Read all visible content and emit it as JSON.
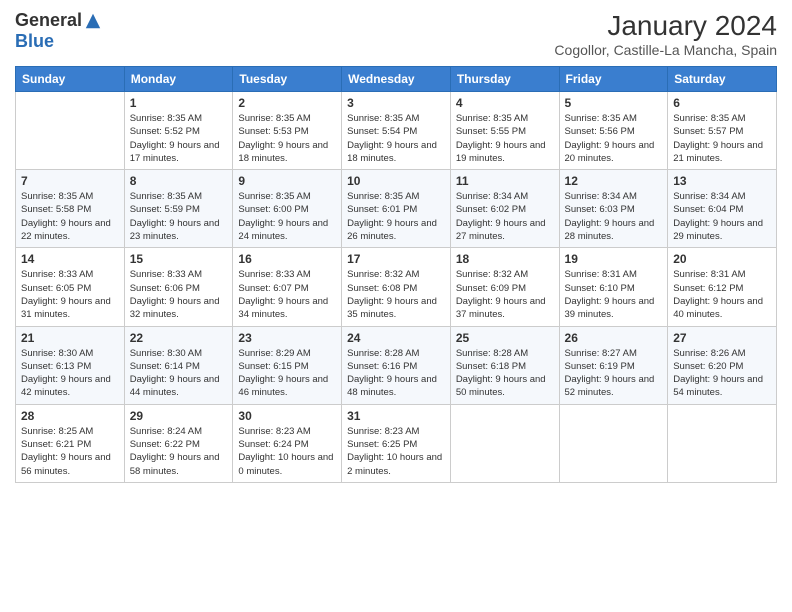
{
  "logo": {
    "general": "General",
    "blue": "Blue"
  },
  "title": "January 2024",
  "location": "Cogollor, Castille-La Mancha, Spain",
  "days_of_week": [
    "Sunday",
    "Monday",
    "Tuesday",
    "Wednesday",
    "Thursday",
    "Friday",
    "Saturday"
  ],
  "weeks": [
    [
      {
        "day": "",
        "sunrise": "",
        "sunset": "",
        "daylight": ""
      },
      {
        "day": "1",
        "sunrise": "8:35 AM",
        "sunset": "5:52 PM",
        "daylight": "9 hours and 17 minutes."
      },
      {
        "day": "2",
        "sunrise": "8:35 AM",
        "sunset": "5:53 PM",
        "daylight": "9 hours and 18 minutes."
      },
      {
        "day": "3",
        "sunrise": "8:35 AM",
        "sunset": "5:54 PM",
        "daylight": "9 hours and 18 minutes."
      },
      {
        "day": "4",
        "sunrise": "8:35 AM",
        "sunset": "5:55 PM",
        "daylight": "9 hours and 19 minutes."
      },
      {
        "day": "5",
        "sunrise": "8:35 AM",
        "sunset": "5:56 PM",
        "daylight": "9 hours and 20 minutes."
      },
      {
        "day": "6",
        "sunrise": "8:35 AM",
        "sunset": "5:57 PM",
        "daylight": "9 hours and 21 minutes."
      }
    ],
    [
      {
        "day": "7",
        "sunrise": "8:35 AM",
        "sunset": "5:58 PM",
        "daylight": "9 hours and 22 minutes."
      },
      {
        "day": "8",
        "sunrise": "8:35 AM",
        "sunset": "5:59 PM",
        "daylight": "9 hours and 23 minutes."
      },
      {
        "day": "9",
        "sunrise": "8:35 AM",
        "sunset": "6:00 PM",
        "daylight": "9 hours and 24 minutes."
      },
      {
        "day": "10",
        "sunrise": "8:35 AM",
        "sunset": "6:01 PM",
        "daylight": "9 hours and 26 minutes."
      },
      {
        "day": "11",
        "sunrise": "8:34 AM",
        "sunset": "6:02 PM",
        "daylight": "9 hours and 27 minutes."
      },
      {
        "day": "12",
        "sunrise": "8:34 AM",
        "sunset": "6:03 PM",
        "daylight": "9 hours and 28 minutes."
      },
      {
        "day": "13",
        "sunrise": "8:34 AM",
        "sunset": "6:04 PM",
        "daylight": "9 hours and 29 minutes."
      }
    ],
    [
      {
        "day": "14",
        "sunrise": "8:33 AM",
        "sunset": "6:05 PM",
        "daylight": "9 hours and 31 minutes."
      },
      {
        "day": "15",
        "sunrise": "8:33 AM",
        "sunset": "6:06 PM",
        "daylight": "9 hours and 32 minutes."
      },
      {
        "day": "16",
        "sunrise": "8:33 AM",
        "sunset": "6:07 PM",
        "daylight": "9 hours and 34 minutes."
      },
      {
        "day": "17",
        "sunrise": "8:32 AM",
        "sunset": "6:08 PM",
        "daylight": "9 hours and 35 minutes."
      },
      {
        "day": "18",
        "sunrise": "8:32 AM",
        "sunset": "6:09 PM",
        "daylight": "9 hours and 37 minutes."
      },
      {
        "day": "19",
        "sunrise": "8:31 AM",
        "sunset": "6:10 PM",
        "daylight": "9 hours and 39 minutes."
      },
      {
        "day": "20",
        "sunrise": "8:31 AM",
        "sunset": "6:12 PM",
        "daylight": "9 hours and 40 minutes."
      }
    ],
    [
      {
        "day": "21",
        "sunrise": "8:30 AM",
        "sunset": "6:13 PM",
        "daylight": "9 hours and 42 minutes."
      },
      {
        "day": "22",
        "sunrise": "8:30 AM",
        "sunset": "6:14 PM",
        "daylight": "9 hours and 44 minutes."
      },
      {
        "day": "23",
        "sunrise": "8:29 AM",
        "sunset": "6:15 PM",
        "daylight": "9 hours and 46 minutes."
      },
      {
        "day": "24",
        "sunrise": "8:28 AM",
        "sunset": "6:16 PM",
        "daylight": "9 hours and 48 minutes."
      },
      {
        "day": "25",
        "sunrise": "8:28 AM",
        "sunset": "6:18 PM",
        "daylight": "9 hours and 50 minutes."
      },
      {
        "day": "26",
        "sunrise": "8:27 AM",
        "sunset": "6:19 PM",
        "daylight": "9 hours and 52 minutes."
      },
      {
        "day": "27",
        "sunrise": "8:26 AM",
        "sunset": "6:20 PM",
        "daylight": "9 hours and 54 minutes."
      }
    ],
    [
      {
        "day": "28",
        "sunrise": "8:25 AM",
        "sunset": "6:21 PM",
        "daylight": "9 hours and 56 minutes."
      },
      {
        "day": "29",
        "sunrise": "8:24 AM",
        "sunset": "6:22 PM",
        "daylight": "9 hours and 58 minutes."
      },
      {
        "day": "30",
        "sunrise": "8:23 AM",
        "sunset": "6:24 PM",
        "daylight": "10 hours and 0 minutes."
      },
      {
        "day": "31",
        "sunrise": "8:23 AM",
        "sunset": "6:25 PM",
        "daylight": "10 hours and 2 minutes."
      },
      {
        "day": "",
        "sunrise": "",
        "sunset": "",
        "daylight": ""
      },
      {
        "day": "",
        "sunrise": "",
        "sunset": "",
        "daylight": ""
      },
      {
        "day": "",
        "sunrise": "",
        "sunset": "",
        "daylight": ""
      }
    ]
  ],
  "labels": {
    "sunrise": "Sunrise:",
    "sunset": "Sunset:",
    "daylight": "Daylight:"
  }
}
